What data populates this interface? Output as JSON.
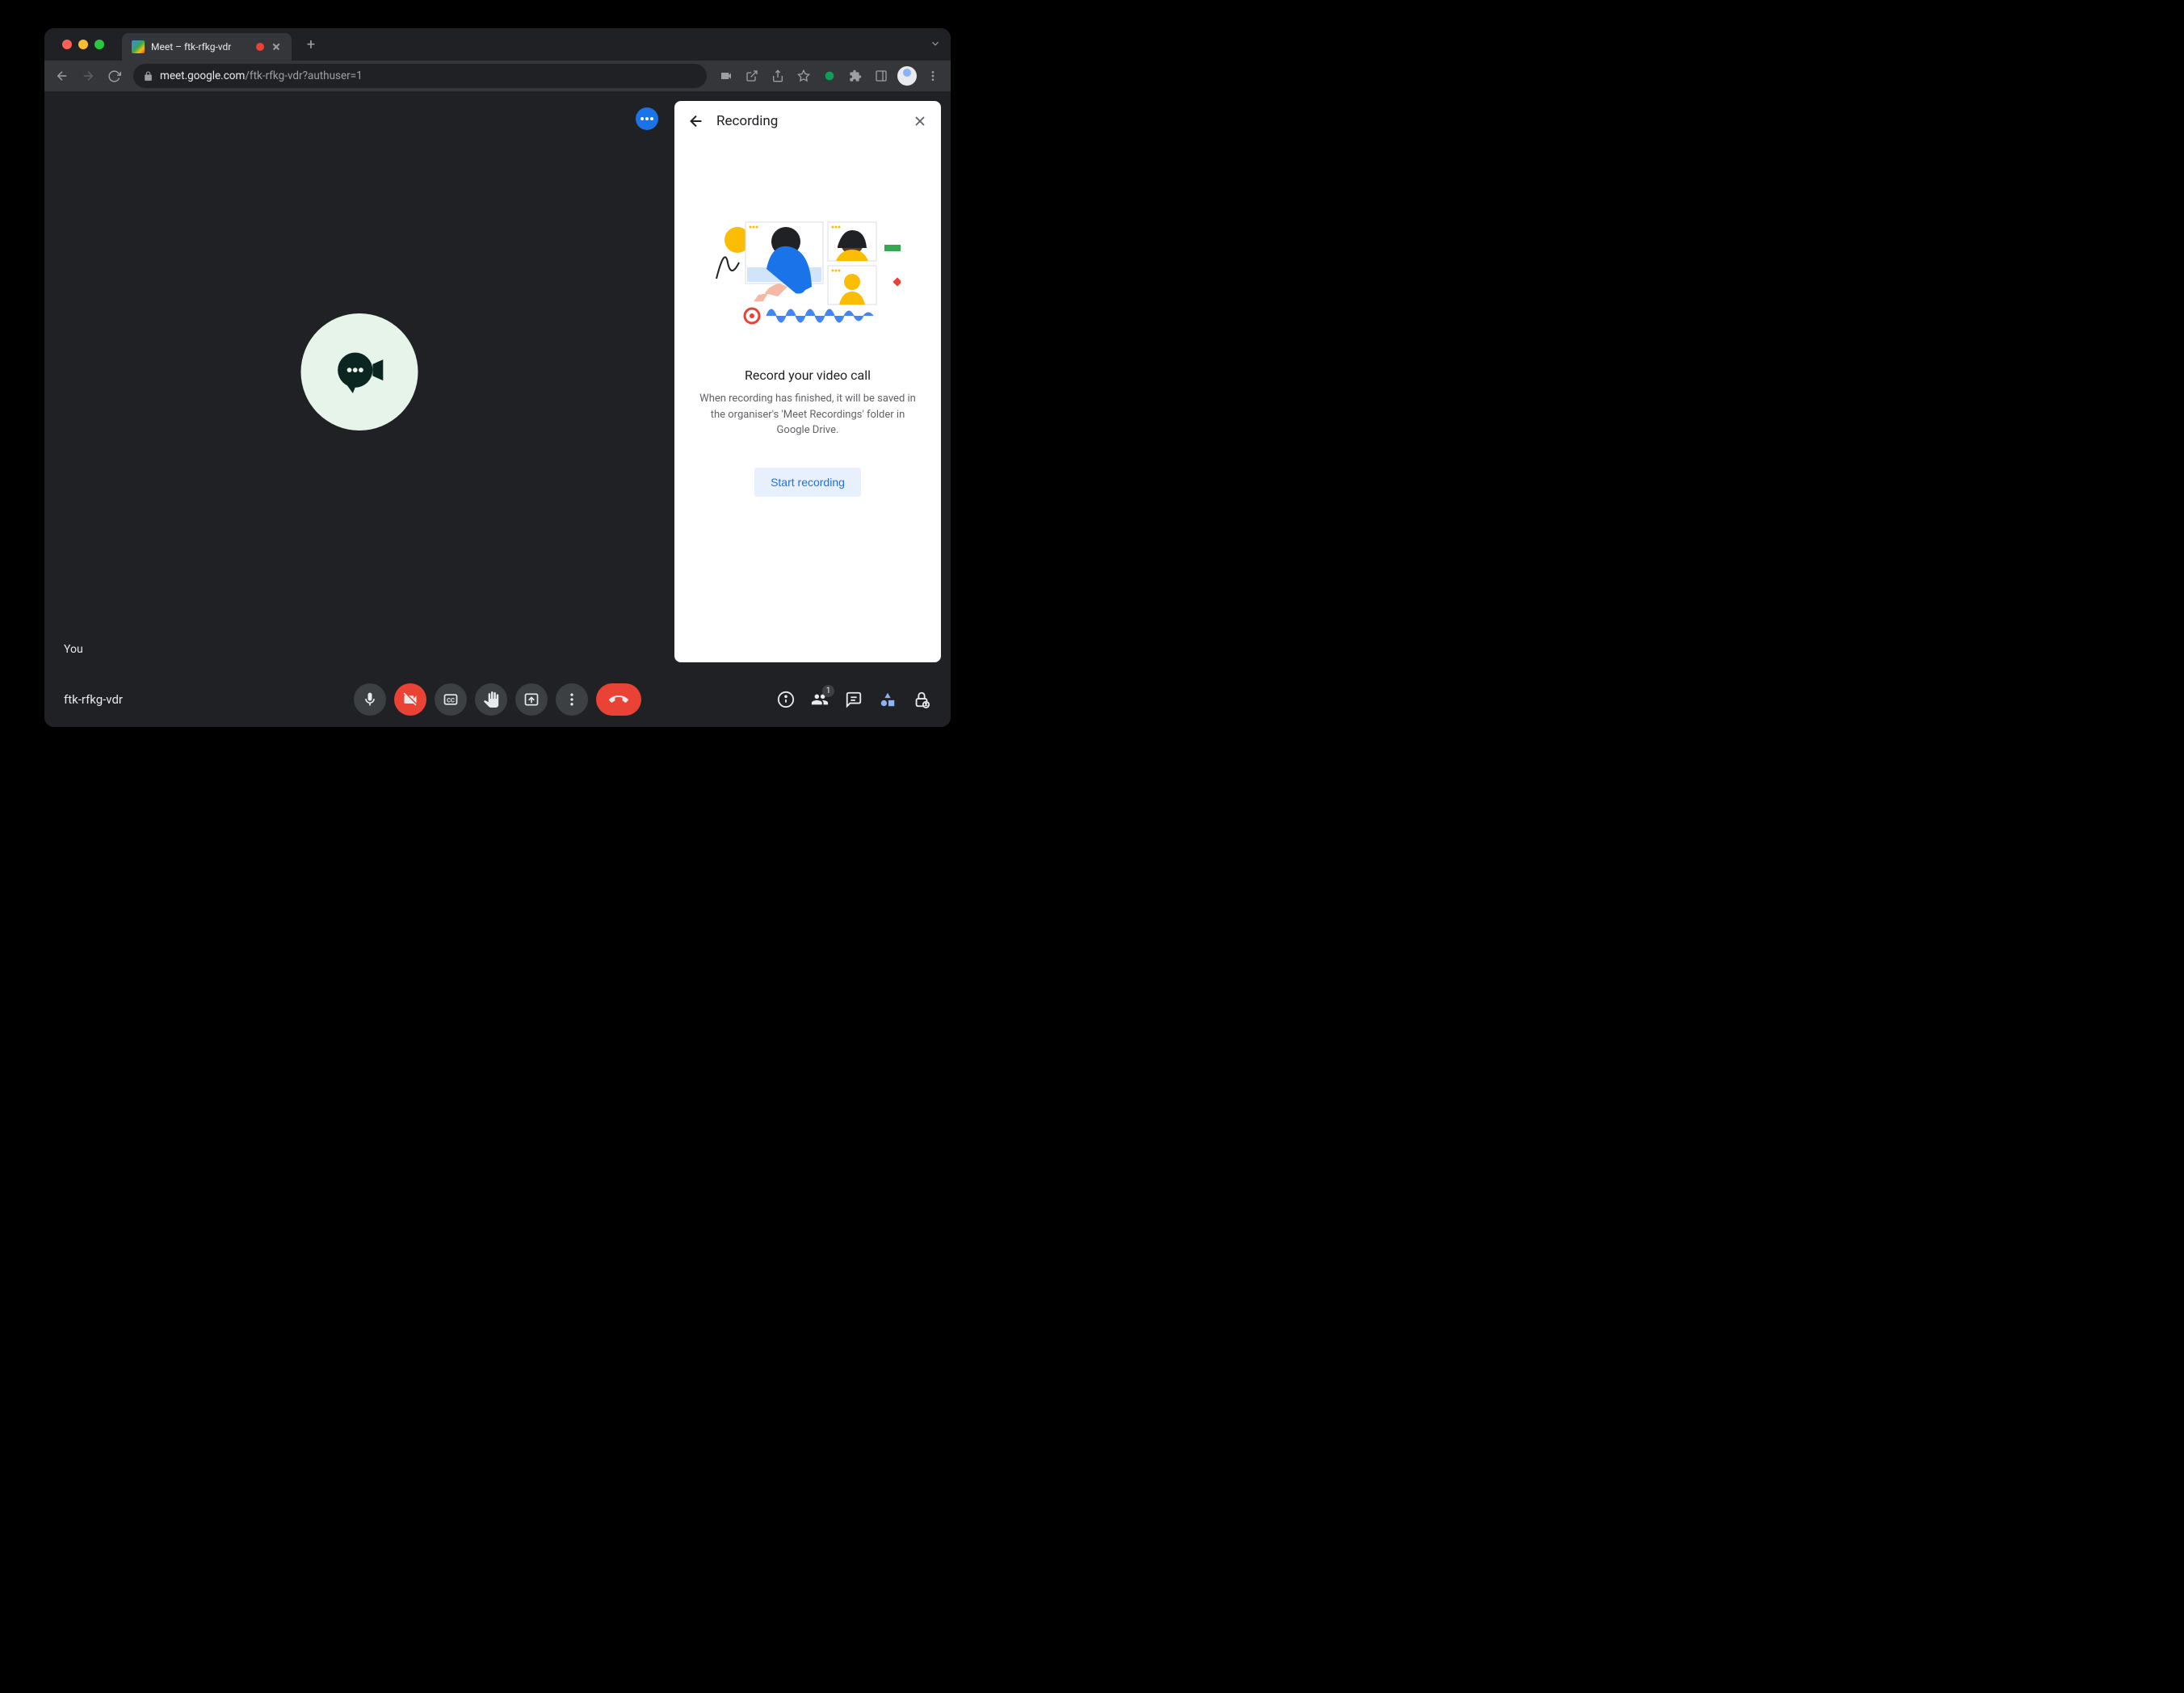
{
  "browser": {
    "tab_title": "Meet – ftk-rfkg-vdr",
    "url_domain": "meet.google.com",
    "url_path": "/ftk-rfkg-vdr?authuser=1"
  },
  "stage": {
    "you_label": "You"
  },
  "panel": {
    "title": "Recording",
    "heading": "Record your video call",
    "description": "When recording has finished, it will be saved in the organiser's 'Meet Recordings' folder in Google Drive.",
    "start_button": "Start recording"
  },
  "bottom": {
    "meeting_code": "ftk-rfkg-vdr",
    "participant_count": "1"
  }
}
